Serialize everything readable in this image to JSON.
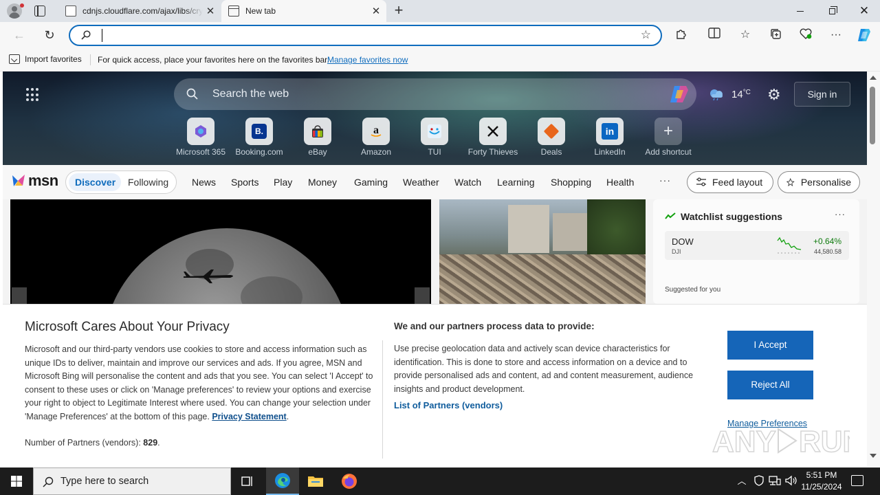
{
  "browser": {
    "tabs": [
      {
        "title": "cdnjs.cloudflare.com/ajax/libs/crypto-js"
      },
      {
        "title": "New tab"
      }
    ],
    "address": {
      "value": "",
      "placeholder": ""
    },
    "favorites_bar": {
      "import_label": "Import favorites",
      "message": "For quick access, place your favorites here on the favorites bar.",
      "manage_link": "Manage favorites now"
    }
  },
  "msn": {
    "search_placeholder": "Search the web",
    "weather": {
      "temp": "14",
      "unit": "°C"
    },
    "signin": "Sign in",
    "shortcuts": [
      {
        "label": "Microsoft 365",
        "icon": "microsoft-365-icon"
      },
      {
        "label": "Booking.com",
        "icon": "booking-icon"
      },
      {
        "label": "eBay",
        "icon": "ebay-icon"
      },
      {
        "label": "Amazon",
        "icon": "amazon-icon"
      },
      {
        "label": "TUI",
        "icon": "tui-icon"
      },
      {
        "label": "Forty Thieves",
        "icon": "forty-thieves-icon"
      },
      {
        "label": "Deals",
        "icon": "deals-icon"
      },
      {
        "label": "LinkedIn",
        "icon": "linkedin-icon"
      },
      {
        "label": "Add shortcut",
        "icon": "plus-icon"
      }
    ],
    "logo_text": "msn",
    "feed_tabs": {
      "discover": "Discover",
      "following": "Following"
    },
    "nav": [
      "News",
      "Sports",
      "Play",
      "Money",
      "Gaming",
      "Weather",
      "Watch",
      "Learning",
      "Shopping",
      "Health"
    ],
    "nav_more": "···",
    "feed_layout": "Feed layout",
    "personalise": "Personalise",
    "watchlist": {
      "title": "Watchlist suggestions",
      "more": "···",
      "stock": {
        "name": "DOW",
        "symbol": "DJI",
        "change": "+0.64%",
        "value": "44,580.58"
      },
      "suggested_label": "Suggested for you"
    }
  },
  "privacy": {
    "title": "Microsoft Cares About Your Privacy",
    "body": "Microsoft and our third-party vendors use cookies to store and access information such as unique IDs to deliver, maintain and improve our services and ads. If you agree, MSN and Microsoft Bing will personalise the content and ads that you see. You can select 'I Accept' to consent to these uses or click on 'Manage preferences' to review your options and exercise your right to object to Legitimate Interest where used.  You can change your selection under 'Manage Preferences' at the bottom of this page.",
    "privacy_link": "Privacy Statement",
    "partners_count_label": "Number of Partners (vendors):",
    "partners_count": "829",
    "subtitle": "We and our partners process data to provide:",
    "description": "Use precise geolocation data and actively scan device characteristics for identification. This is done to store and access information on a device and to provide personalised ads and content, ad and content measurement, audience insights and product development.",
    "partners_link": "List of Partners (vendors)",
    "accept": "I Accept",
    "reject": "Reject All",
    "manage": "Manage Preferences"
  },
  "taskbar": {
    "search_placeholder": "Type here to search",
    "time": "5:51 PM",
    "date": "11/25/2024"
  },
  "colors": {
    "accent": "#0f6cbd",
    "button": "#1565b8",
    "taskbar": "#1c1c1c"
  }
}
